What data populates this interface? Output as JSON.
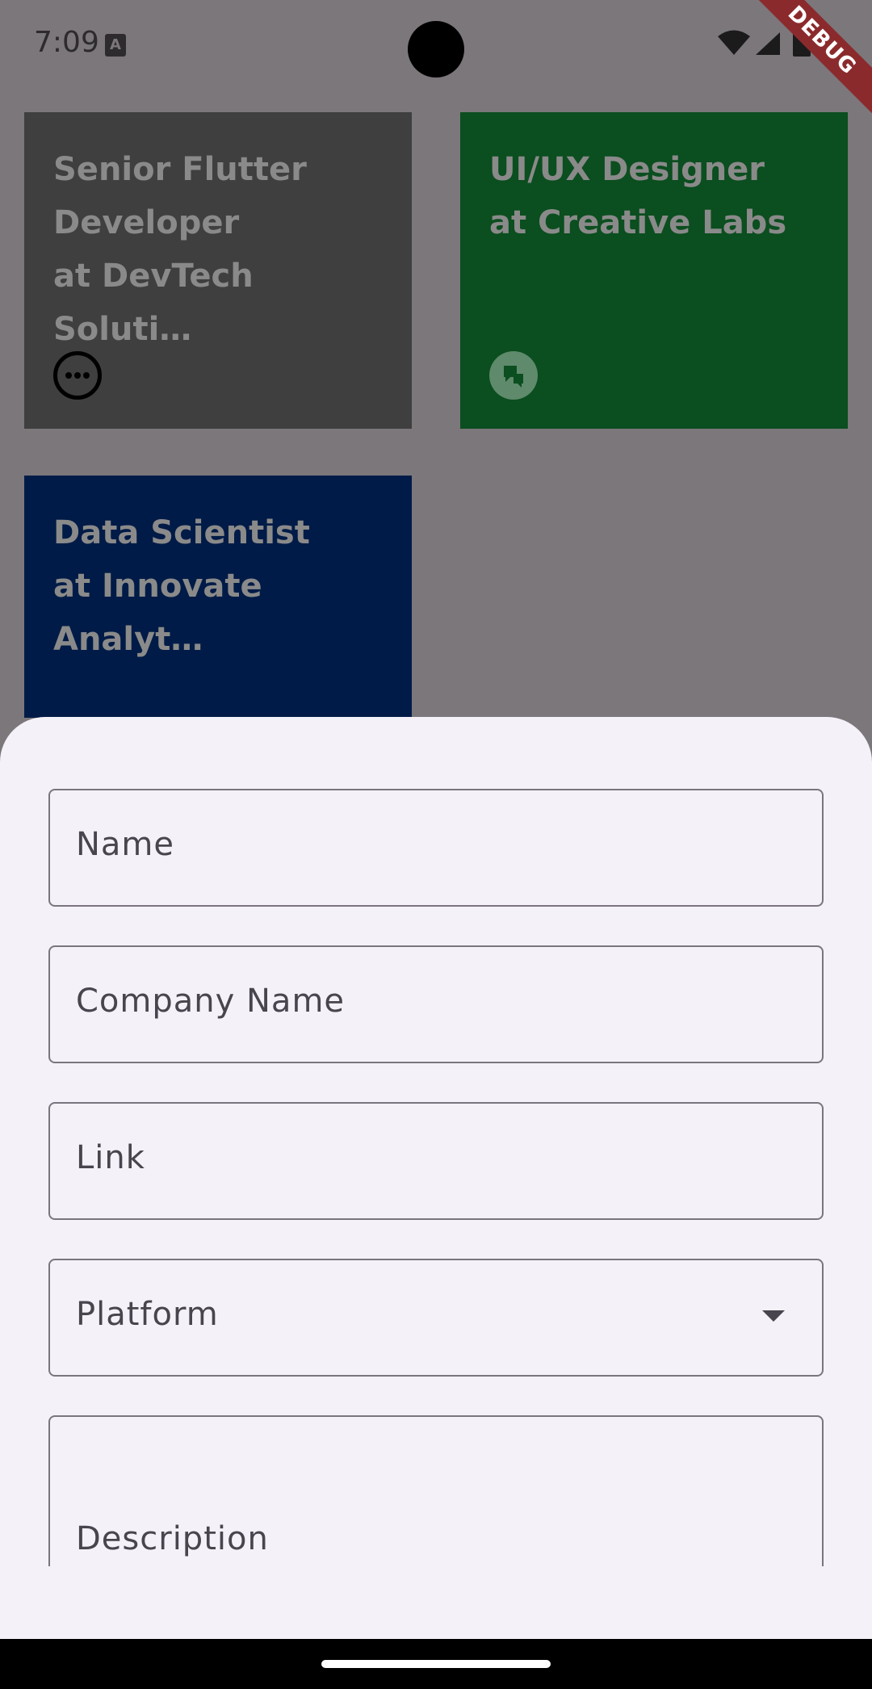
{
  "status_bar": {
    "time": "7:09",
    "notification_icon": "a-icon"
  },
  "debug_banner": "DEBUG",
  "cards": [
    {
      "title": "Senior Flutter\nDeveloper\nat DevTech Soluti…",
      "color": "#3f3f3f",
      "icon": "more-horiz-circle-icon"
    },
    {
      "title": "UI/UX Designer\nat Creative Labs",
      "color": "#0b4e1f",
      "icon": "chat-bubbles-icon"
    },
    {
      "title": "Data Scientist\nat Innovate Analyt…",
      "color": "#001b47",
      "icon": ""
    }
  ],
  "form": {
    "name_label": "Name",
    "company_label": "Company Name",
    "link_label": "Link",
    "platform_label": "Platform",
    "description_label": "Description"
  },
  "colors": {
    "scrim": "#7b777b",
    "sheet_background": "#f4f1f8",
    "field_border": "#7a757f",
    "label_text": "#49454f"
  }
}
